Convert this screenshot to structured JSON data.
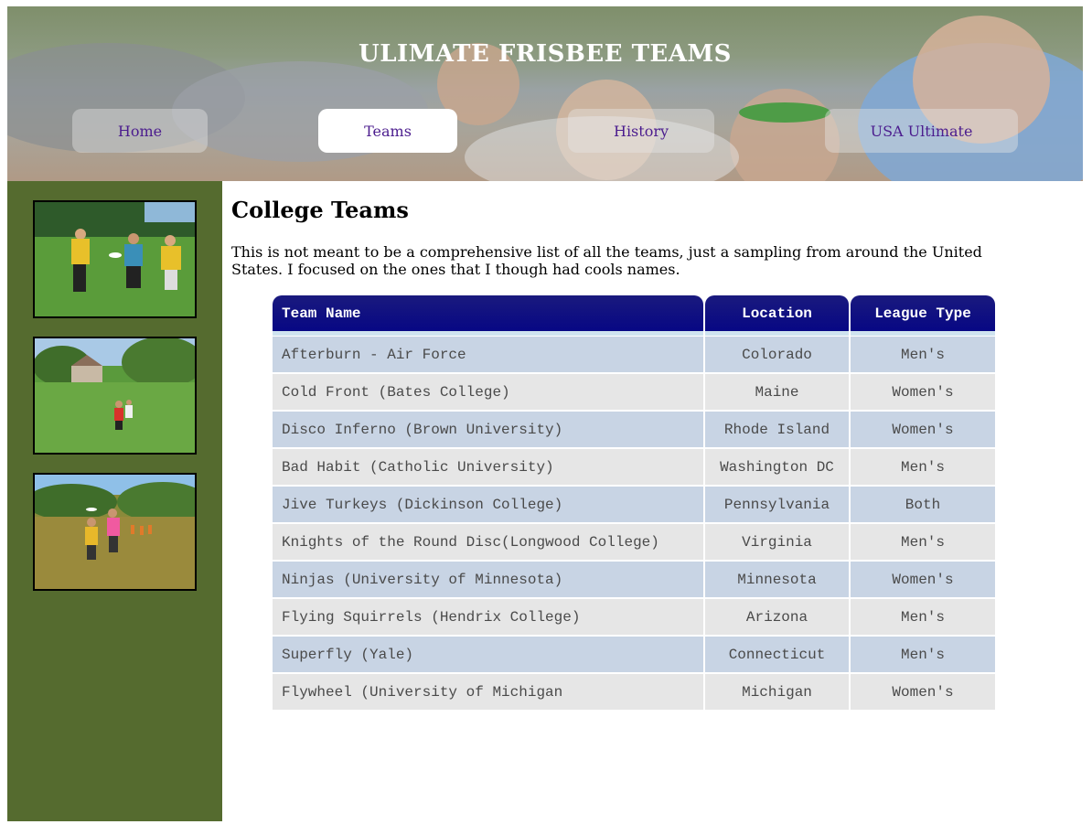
{
  "header": {
    "title": "ULIMATE FRISBEE TEAMS",
    "nav": [
      {
        "label": "Home",
        "active": false
      },
      {
        "label": "Teams",
        "active": true
      },
      {
        "label": "History",
        "active": false
      },
      {
        "label": "USA Ultimate",
        "active": false
      }
    ]
  },
  "sidebar": {
    "photos": [
      "ultimate-players-photo",
      "ultimate-field-photo",
      "ultimate-throw-photo"
    ]
  },
  "main": {
    "heading": "College Teams",
    "intro": "This is not meant to be a comprehensive list of all the teams, just a sampling from around the United States. I focused on the ones that I though had cools names.",
    "table": {
      "columns": [
        "Team Name",
        "Location",
        "League Type"
      ],
      "rows": [
        [
          "Afterburn - Air Force",
          "Colorado",
          "Men's"
        ],
        [
          "Cold Front (Bates College)",
          "Maine",
          "Women's"
        ],
        [
          "Disco Inferno (Brown University)",
          "Rhode Island",
          "Women's"
        ],
        [
          "Bad Habit (Catholic University)",
          "Washington DC",
          "Men's"
        ],
        [
          "Jive Turkeys (Dickinson College)",
          "Pennsylvania",
          "Both"
        ],
        [
          "Knights of the Round Disc(Longwood College)",
          "Virginia",
          "Men's"
        ],
        [
          "Ninjas (University of Minnesota)",
          "Minnesota",
          "Women's"
        ],
        [
          "Flying Squirrels (Hendrix College)",
          "Arizona",
          "Men's"
        ],
        [
          "Superfly (Yale)",
          "Connecticut",
          "Men's"
        ],
        [
          "Flywheel (University of Michigan",
          "Michigan",
          "Women's"
        ]
      ]
    }
  },
  "colors": {
    "sidebar": "#556b2f",
    "table_header": "#0a0a80",
    "row_odd": "#c8d4e4",
    "row_even": "#e6e6e6",
    "nav_text": "#4b1c8e"
  }
}
